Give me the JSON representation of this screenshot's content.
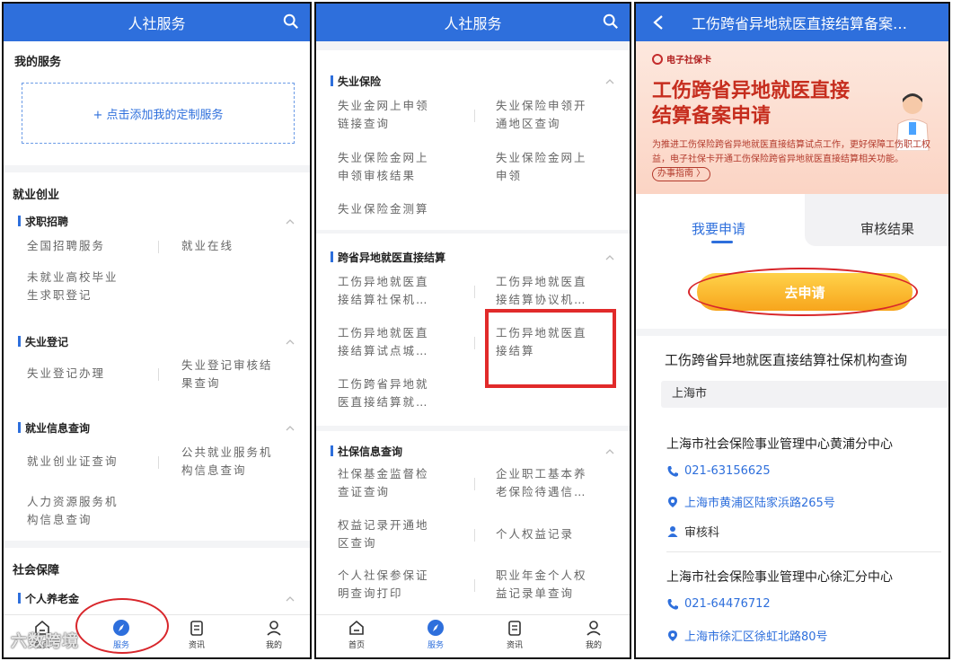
{
  "panel1": {
    "header_title": "人社服务",
    "my_services_title": "我的服务",
    "add_custom_service": "+ 点击添加我的定制服务",
    "section_employment": "就业创业",
    "sub_job": "求职招聘",
    "job_items": [
      "全国招聘服务",
      "就业在线",
      "未就业高校毕业",
      "生求职登记"
    ],
    "sub_unemp_reg": "失业登记",
    "unemp_reg_items": [
      "失业登记办理",
      "失业登记审核结",
      "果查询"
    ],
    "sub_emp_info": "就业信息查询",
    "emp_info_items": [
      "就业创业证查询",
      "公共就业服务机",
      "构信息查询",
      "人力资源服务机",
      "构信息查询"
    ],
    "section_social": "社会保障",
    "sub_pension": "个人养老金",
    "tabs": [
      "首页",
      "服务",
      "资讯",
      "我的"
    ],
    "watermark": "六数跨境"
  },
  "panel2": {
    "header_title": "人社服务",
    "sub_unemp_ins": "失业保险",
    "unemp_items": [
      "失业金网上申领",
      "链接查询",
      "失业保险申领开",
      "通地区查询",
      "失业保险金网上",
      "申领审核结果",
      "失业保险金网上",
      "申领",
      "失业保险金测算"
    ],
    "sub_cross": "跨省异地就医直接结算",
    "cross_items": [
      "工伤异地就医直",
      "接结算社保机…",
      "工伤异地就医直",
      "接结算协议机…",
      "工伤异地就医直",
      "接结算试点城…",
      "工伤异地就医直",
      "接结算",
      "工伤跨省异地就",
      "医直接结算就…"
    ],
    "sub_social_info": "社保信息查询",
    "social_items": [
      "社保基金监督检",
      "查证查询",
      "企业职工基本养",
      "老保险待遇信…",
      "权益记录开通地",
      "区查询",
      "个人权益记录",
      "个人社保参保证",
      "明查询打印",
      "职业年金个人权",
      "益记录单查询"
    ],
    "tabs": [
      "首页",
      "服务",
      "资讯",
      "我的"
    ]
  },
  "panel3": {
    "header_title": "工伤跨省异地就医直接结算备案…",
    "brand": "电子社保卡",
    "banner_title_line1": "工伤跨省异地就医直接",
    "banner_title_line2": "结算备案申请",
    "banner_desc": "为推进工伤保险跨省异地就医直接结算试点工作，更好保障工伤职工权益，电子社保卡开通工伤保险跨省异地就医直接结算相关功能。",
    "guide": "办事指南 〉",
    "tab_apply": "我要申请",
    "tab_result": "审核结果",
    "apply_button": "去申请",
    "query_title": "工伤跨省异地就医直接结算社保机构查询",
    "city": "上海市",
    "org1_name": "上海市社会保险事业管理中心黄浦分中心",
    "org1_phone": "021-63156625",
    "org1_address": "上海市黄浦区陆家浜路265号",
    "org1_dept": "审核科",
    "org2_name": "上海市社会保险事业管理中心徐汇分中心",
    "org2_phone": "021-64476712",
    "org2_address": "上海市徐汇区徐虹北路80号"
  },
  "colors": {
    "primary": "#2e6fdc",
    "highlight_red": "#e12a2a",
    "banner_red": "#c62d1e",
    "button_orange": "#f7a51c"
  }
}
